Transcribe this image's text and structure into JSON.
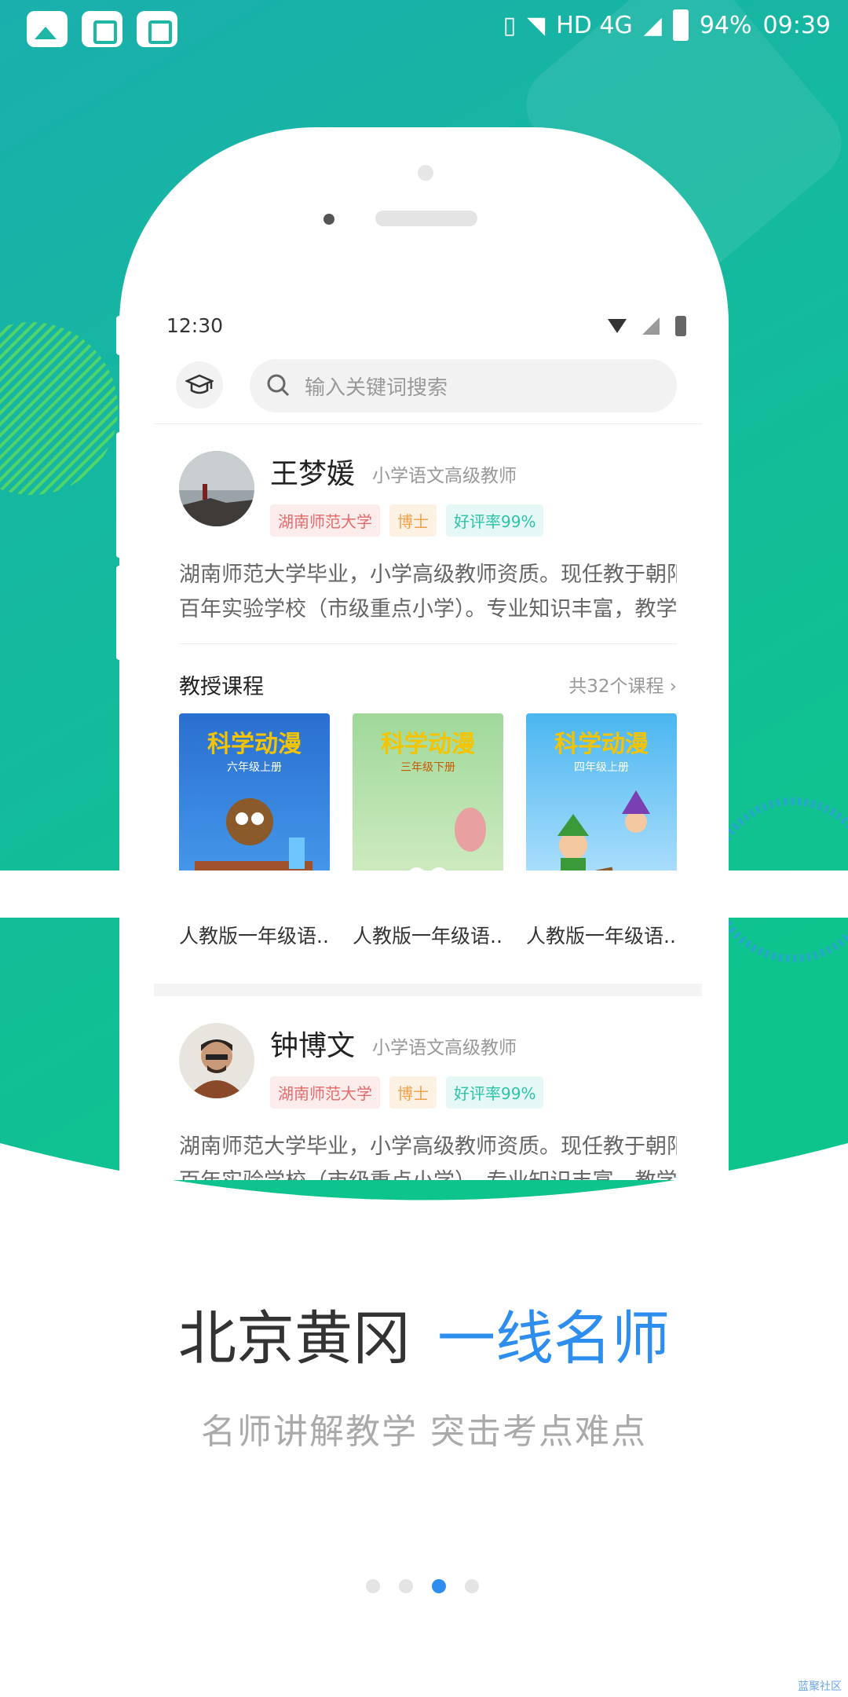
{
  "system_status": {
    "network": "HD 4G",
    "battery": "94%",
    "time": "09:39"
  },
  "phone_screen": {
    "status_time": "12:30",
    "search": {
      "placeholder": "输入关键词搜索"
    },
    "teachers": [
      {
        "name": "王梦媛",
        "title": "小学语文高级教师",
        "tags": [
          "湖南师范大学",
          "博士",
          "好评率99%"
        ],
        "description_lines": [
          "湖南师范大学毕业，小学高级教师资质。现任教于朝阳区",
          "百年实验学校（市级重点小学）。专业知识丰富，教学..."
        ],
        "courses_label": "教授课程",
        "courses_count": "共32个课程",
        "courses": [
          {
            "cover_title": "科学动漫",
            "cover_sub": "六年级上册",
            "name": "人教版一年级语..."
          },
          {
            "cover_title": "科学动漫",
            "cover_sub": "三年级下册",
            "name": "人教版一年级语..."
          },
          {
            "cover_title": "科学动漫",
            "cover_sub": "四年级上册",
            "name": "人教版一年级语..."
          }
        ]
      },
      {
        "name": "钟博文",
        "title": "小学语文高级教师",
        "tags": [
          "湖南师范大学",
          "博士",
          "好评率99%"
        ],
        "description_lines": [
          "湖南师范大学毕业，小学高级教师资质。现任教于朝阳区",
          "百年实验学校（市级重点小学）。专业知识丰富，教学"
        ]
      }
    ]
  },
  "promo": {
    "headline_gray": "北京黄冈",
    "headline_blue": "一线名师",
    "subline": "名师讲解教学  突击考点难点"
  },
  "pager": {
    "total": 4,
    "active": 3
  },
  "watermark": "蓝聚社区",
  "colors": {
    "accent_blue": "#2d8ef0",
    "gradient_teal": "#19b3a8",
    "gradient_green": "#0fc18f"
  }
}
